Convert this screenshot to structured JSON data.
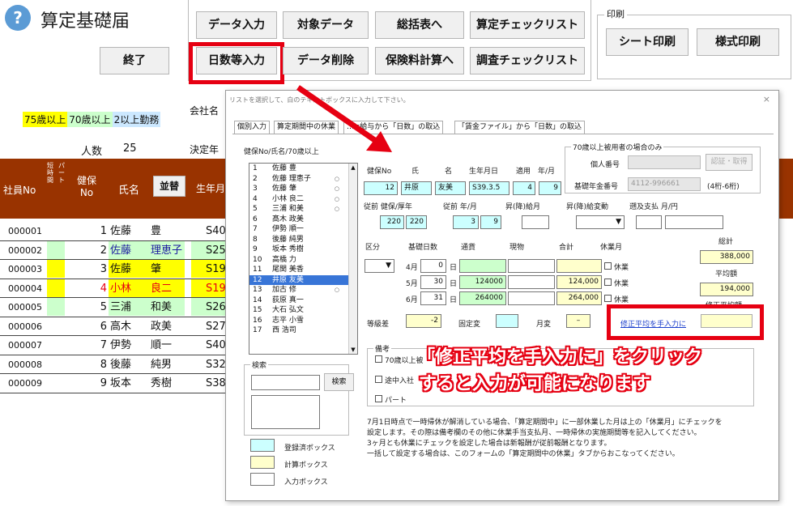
{
  "app": {
    "title": "算定基礎届",
    "end_label": "終了",
    "help_icon": "?"
  },
  "toolbar": {
    "data_input": "データ入力",
    "target_data": "対象データ",
    "summary": "総括表へ",
    "calc_check": "算定チェックリスト",
    "days_input": "日数等入力",
    "data_delete": "データ削除",
    "premium_calc": "保険料計算へ",
    "survey_check": "調査チェックリスト"
  },
  "print": {
    "group": "印刷",
    "sheet": "シート印刷",
    "form": "様式印刷"
  },
  "legend": {
    "over75": "75歳以上",
    "over70": "70歳以上",
    "multi": "2以上勤務"
  },
  "company_label": "会社名",
  "people_label": "人数",
  "people_count": "25",
  "decided_label": "決定年",
  "sort_label": "並替",
  "columns": {
    "emp_no": "社員No",
    "short": "短時間",
    "part": "パート",
    "health_no": "健保No",
    "name": "氏名",
    "birth": "生年月"
  },
  "rows": [
    {
      "no": "000001",
      "h": "1",
      "s": "佐藤",
      "g": "豊",
      "b": "S40",
      "bg": "",
      "side": ""
    },
    {
      "no": "000002",
      "h": "2",
      "s": "佐藤",
      "g": "理恵子",
      "b": "S25.6",
      "bg": "#ccffcc",
      "side": "#ccffcc"
    },
    {
      "no": "000003",
      "h": "3",
      "s": "佐藤",
      "g": "肇",
      "b": "S19.8",
      "bg": "#ffff00",
      "side": "#ffff00"
    },
    {
      "no": "000004",
      "h": "4",
      "s": "小林",
      "g": "良二",
      "b": "S19.8",
      "bg": "#ffff00",
      "side": "#ffff00",
      "red": true
    },
    {
      "no": "000005",
      "h": "5",
      "s": "三浦",
      "g": "和美",
      "b": "S26.7",
      "bg": "#ccffcc",
      "side": "#ccffcc"
    },
    {
      "no": "000006",
      "h": "6",
      "s": "高木",
      "g": "政美",
      "b": "S27",
      "bg": "",
      "side": ""
    },
    {
      "no": "000007",
      "h": "7",
      "s": "伊勢",
      "g": "順一",
      "b": "S40",
      "bg": "",
      "side": ""
    },
    {
      "no": "000008",
      "h": "8",
      "s": "後藤",
      "g": "純男",
      "b": "S32.5",
      "bg": "",
      "side": ""
    },
    {
      "no": "000009",
      "h": "9",
      "s": "坂本",
      "g": "秀樹",
      "b": "S38.4",
      "bg": "",
      "side": ""
    }
  ],
  "dialog": {
    "caption": "リストを選択して、白のテキストボックスに入力して下さい。",
    "close": "×",
    "tabs": [
      "個別入力",
      "算定期間中の休業",
      "…ls給与から「日数」の取込",
      "「賃金ファイル」から「日数」の取込"
    ],
    "list_label": "健保No/氏名/70歳以上",
    "list": [
      {
        "n": "1",
        "name": "佐藤 豊",
        "mk": ""
      },
      {
        "n": "2",
        "name": "佐藤 理恵子",
        "mk": "○"
      },
      {
        "n": "3",
        "name": "佐藤 肇",
        "mk": "○"
      },
      {
        "n": "4",
        "name": "小林 良二",
        "mk": "○"
      },
      {
        "n": "5",
        "name": "三浦 和美",
        "mk": "○"
      },
      {
        "n": "6",
        "name": "髙木 政美",
        "mk": ""
      },
      {
        "n": "7",
        "name": "伊勢 順一",
        "mk": ""
      },
      {
        "n": "8",
        "name": "後藤 純男",
        "mk": ""
      },
      {
        "n": "9",
        "name": "坂本 秀樹",
        "mk": ""
      },
      {
        "n": "10",
        "name": "高橋 力",
        "mk": ""
      },
      {
        "n": "11",
        "name": "尾関 美香",
        "mk": ""
      },
      {
        "n": "12",
        "name": "井原 友美",
        "mk": "",
        "sel": true
      },
      {
        "n": "13",
        "name": "加古 修",
        "mk": "○"
      },
      {
        "n": "14",
        "name": "荻原 真一",
        "mk": ""
      },
      {
        "n": "15",
        "name": "大石 弘文",
        "mk": ""
      },
      {
        "n": "16",
        "name": "志平 小雪",
        "mk": ""
      },
      {
        "n": "17",
        "name": "西 浩司",
        "mk": ""
      }
    ],
    "search": {
      "group": "検索",
      "button": "検索"
    },
    "box_legend": {
      "registered": "登録済ボックス",
      "calc": "計算ボックス",
      "input": "入力ボックス"
    },
    "labels": {
      "health_no": "健保No",
      "surname": "氏",
      "given": "名",
      "birth": "生年月日",
      "applied": "適用",
      "ym": "年/月",
      "prev_pension": "従前 健保/厚年",
      "prev_ym": "従前 年/月",
      "pay_change": "昇(降)給月",
      "pay_var": "昇(降)給変動",
      "retro": "遡及支払 月/円",
      "kubun": "区分",
      "days": "基礎日数",
      "currency": "通貨",
      "goods": "現物",
      "total": "合計",
      "leave": "休業月",
      "sum_total": "総計",
      "average": "平均額",
      "grade_diff": "等級差",
      "fixed": "固定変",
      "month_change": "月変",
      "manual_avg": "修正平均を手入力に",
      "revised_avg": "修正平均額",
      "remarks": "備考",
      "leave_chk": "休業"
    },
    "values": {
      "health_no": "12",
      "surname": "井原",
      "given": "友美",
      "birth": "S39.3.5",
      "ap_y": "4",
      "ap_m": "9",
      "prev_h": "220",
      "prev_p": "220",
      "prev_y": "3",
      "prev_m": "9",
      "m4": "4月",
      "d4": "0",
      "m5": "5月",
      "d5": "30",
      "c5": "124000",
      "t5": "124,000",
      "m6": "6月",
      "d6": "31",
      "c6": "264000",
      "t6": "264,000",
      "day": "日",
      "sum": "388,000",
      "avg": "194,000",
      "grade": "-2",
      "month_change": "–"
    },
    "over70": {
      "group": "70歳以上被用者の場合のみ",
      "personal_no": "個人番号",
      "pension_no": "基礎年金番号",
      "pension_val": "4112-996661",
      "auth": "認証・取得",
      "digits": "(4桁-6桁)"
    },
    "remarks_items": [
      "70歳以上被",
      "途中入社",
      "パート"
    ],
    "notes": [
      "7月1日時点で一時帰休が解消している場合、「算定期間中」に一部休業した月は上の「休業月」にチェックを",
      "設定します。その際は備考欄のその他に休業手当支払月、一時帰休の実施期間等を記入してください。",
      "3ヶ月とも休業にチェックを設定した場合は新報酬が従前報酬となります。",
      "一括して設定する場合は、このフォームの「算定期間中の休業」タブからおこなってください。"
    ]
  },
  "overlay": {
    "line1": "「修正平均を手入力に」をクリック",
    "line2": "すると入力が可能になります"
  },
  "colors": {
    "accent_red": "#e60012",
    "header_brown": "#993300",
    "cyan": "#ccffff",
    "yellow": "#ffffcc"
  }
}
